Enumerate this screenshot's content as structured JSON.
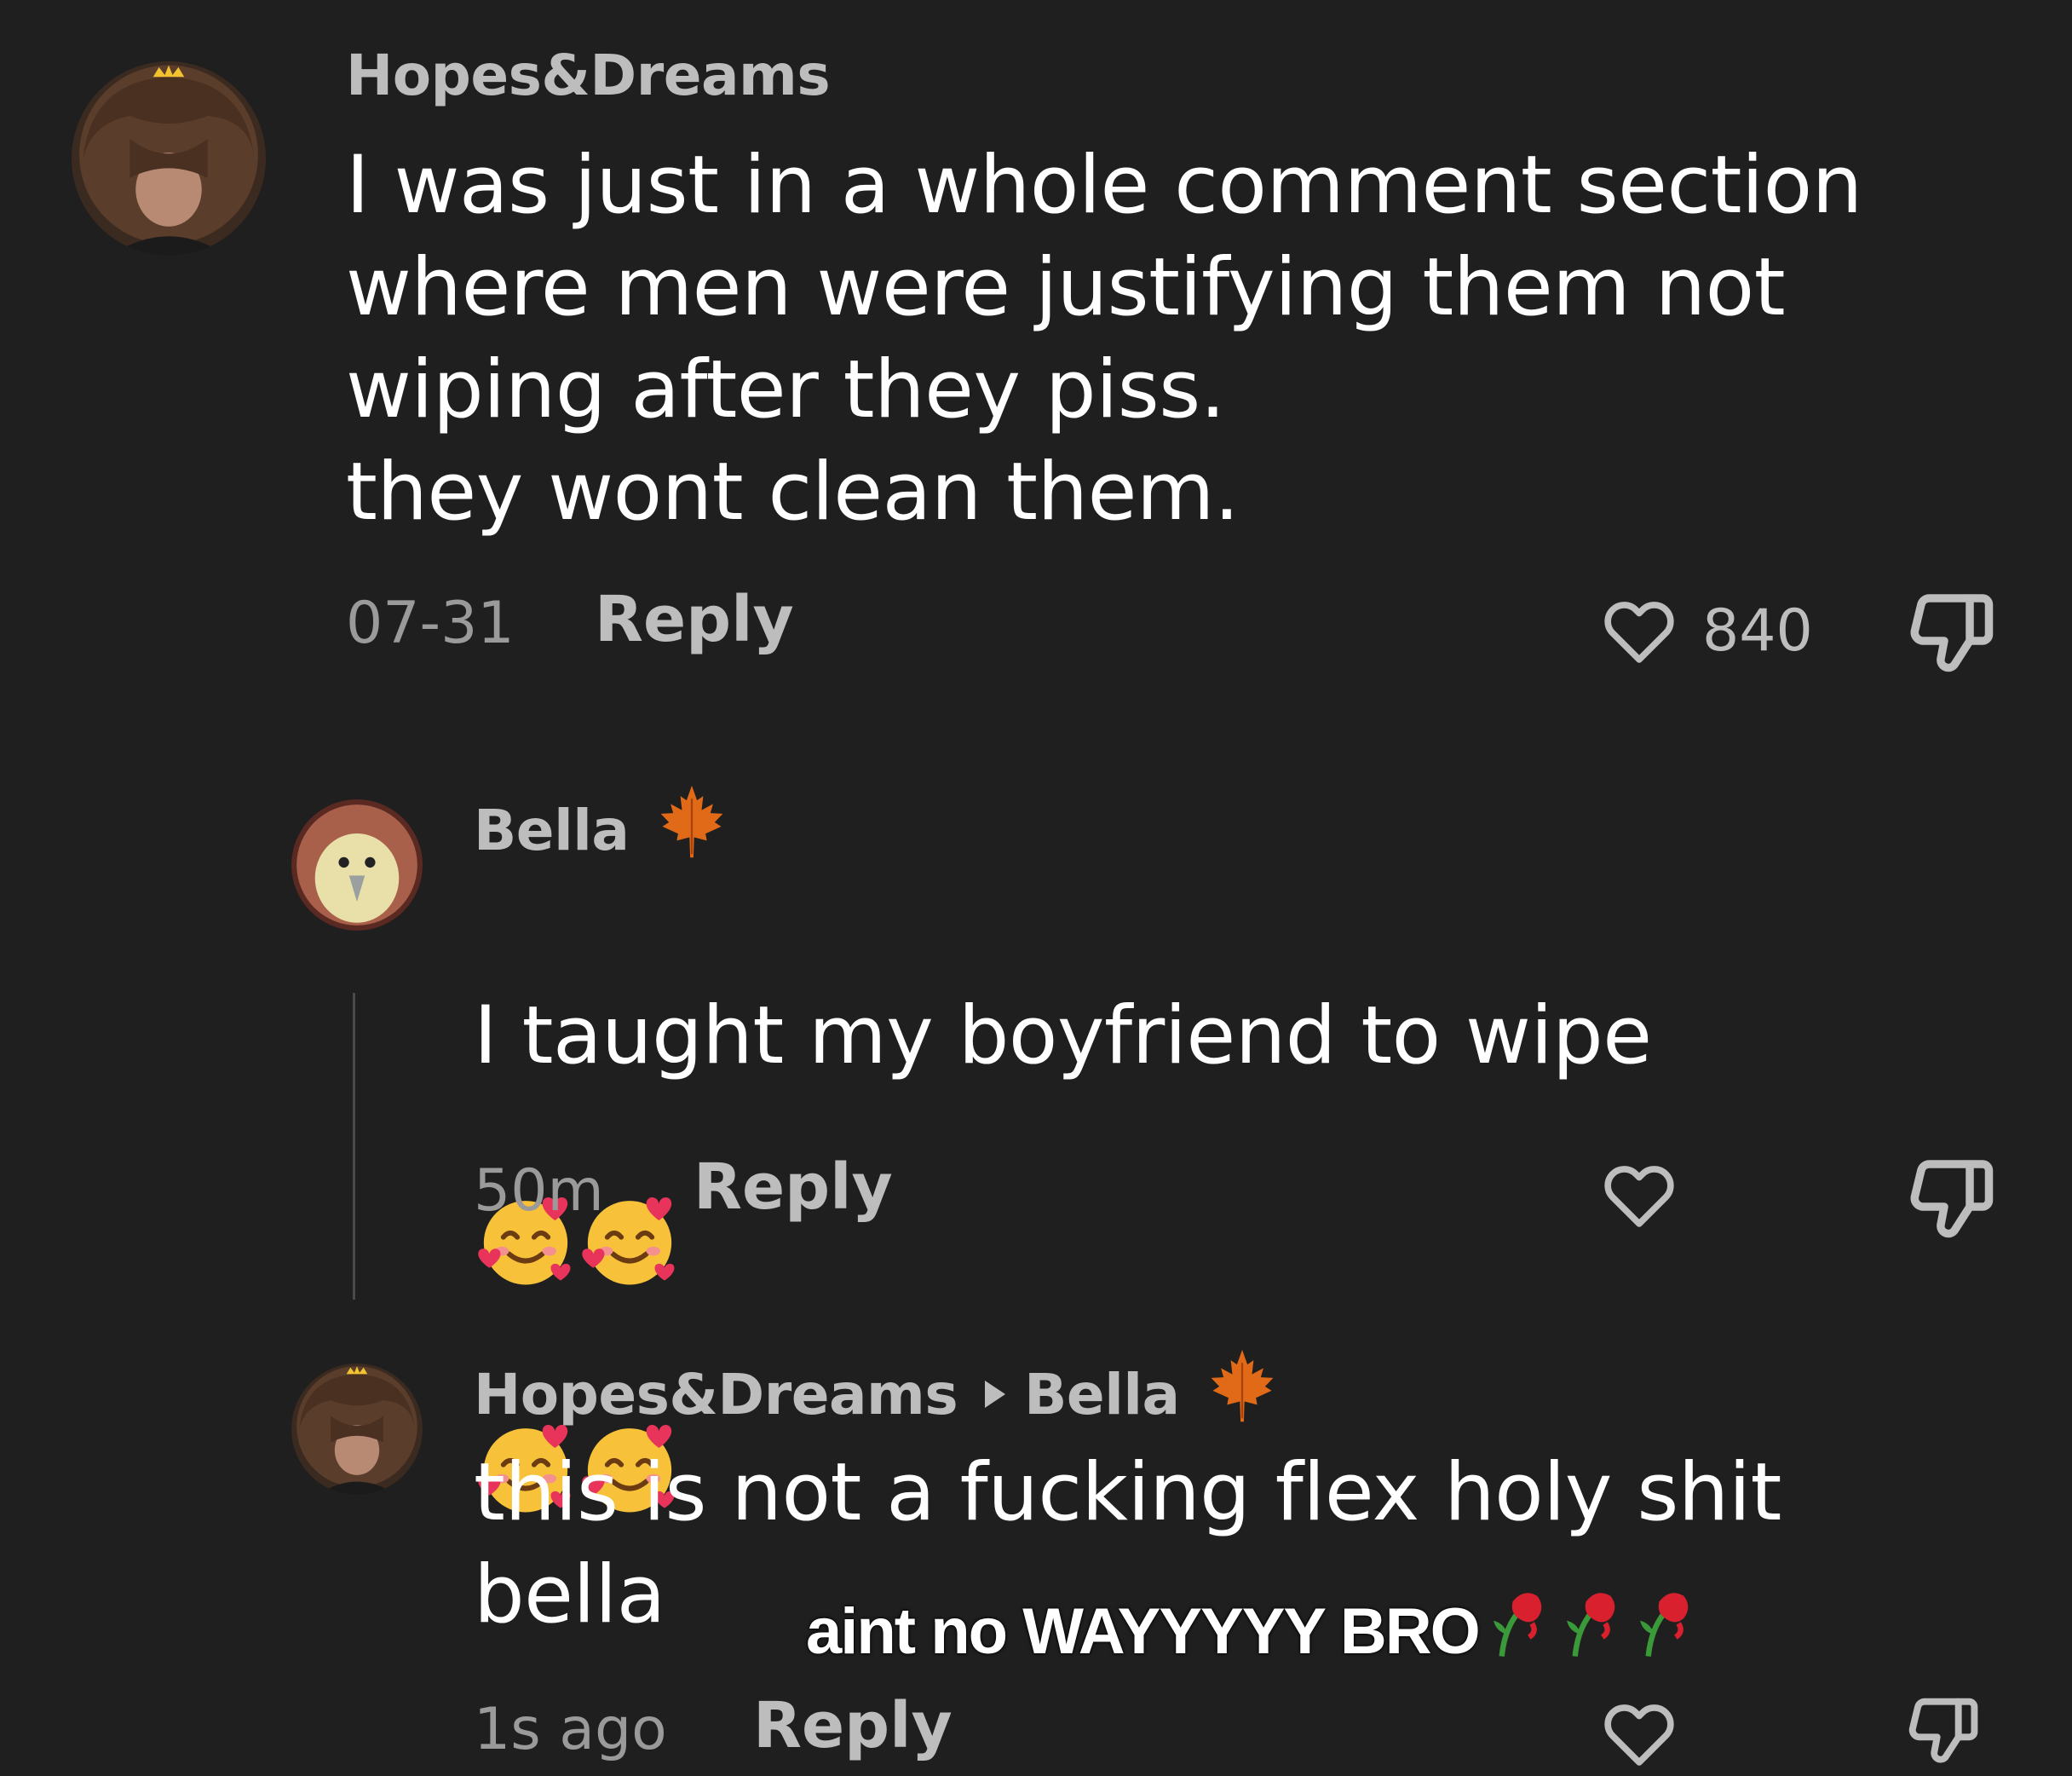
{
  "comments": [
    {
      "username": "Hopes&Dreams",
      "text": "I was just in a whole comment section\nwhere men were justifying them not\nwiping after they piss.\nthey wont clean them.",
      "time": "07-31",
      "reply_label": "Reply",
      "like_count": "840"
    },
    {
      "username": "Bella",
      "text": "I taught my boyfriend to wipe",
      "time": "50m",
      "reply_label": "Reply"
    },
    {
      "username": "Hopes&Dreams",
      "reply_to": "Bella",
      "text": "this is not a fucking flex holy shit\nbella",
      "time": "1s ago",
      "reply_label": "Reply"
    }
  ],
  "caption": "aint no WAYYYYY BRO",
  "icons": {
    "heart": "heart-icon",
    "dislike": "thumbs-down-icon",
    "badge": "maple-leaf-icon",
    "emoji": "smiling-face-with-hearts",
    "caption_emoji": "wilted-rose"
  },
  "colors": {
    "background": "#1f1f1f",
    "text": "#ffffff",
    "muted": "#bdbdbd"
  }
}
